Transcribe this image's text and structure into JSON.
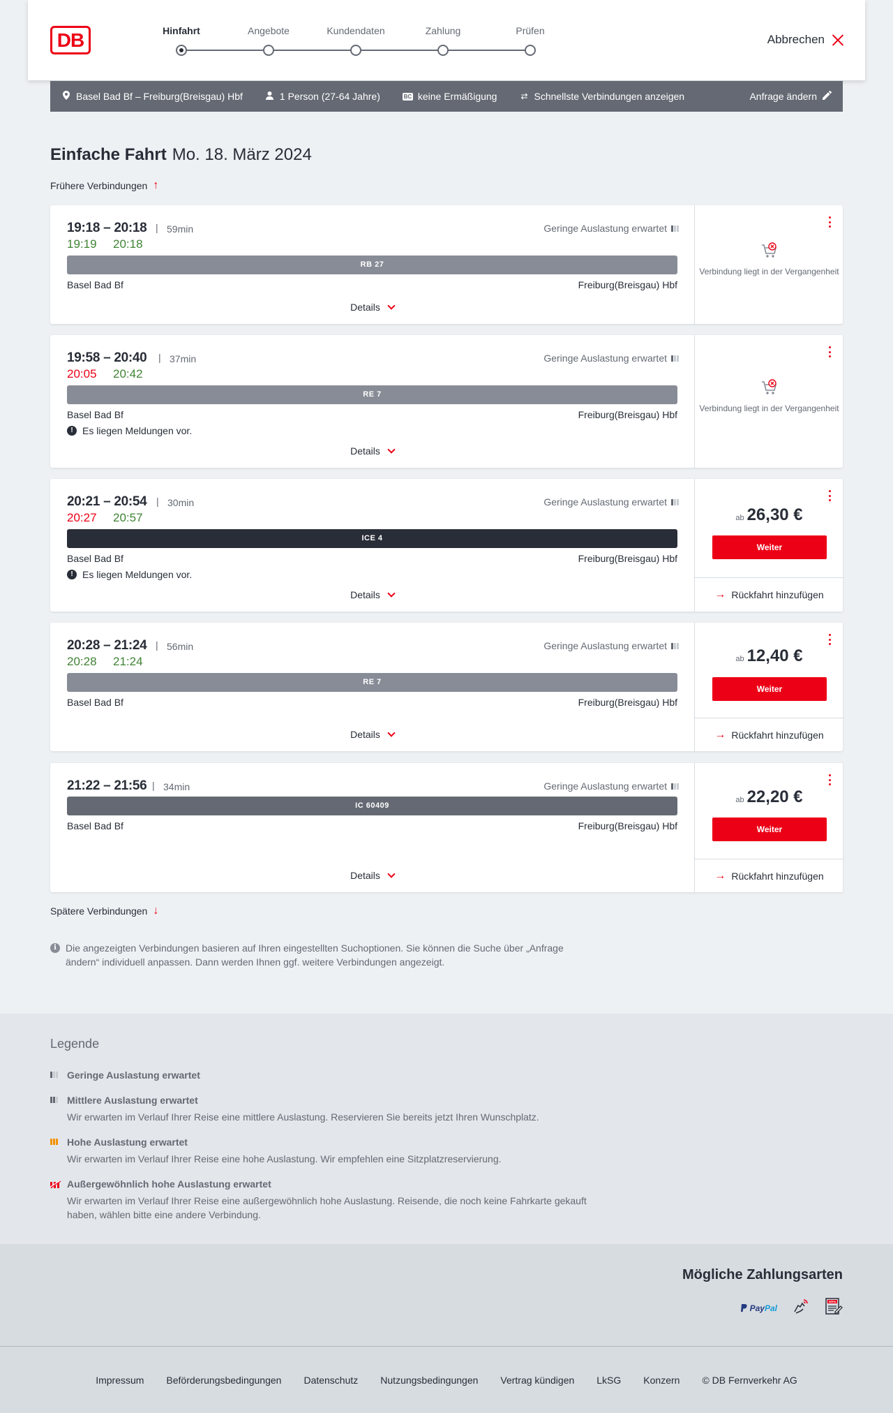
{
  "header": {
    "logo": "DB",
    "steps": [
      "Hinfahrt",
      "Angebote",
      "Kundendaten",
      "Zahlung",
      "Prüfen"
    ],
    "cancel": "Abbrechen"
  },
  "summary": {
    "route": "Basel Bad Bf – Freiburg(Breisgau) Hbf",
    "passengers": "1 Person (27-64 Jahre)",
    "discount": "keine Ermäßigung",
    "fastest": "Schnellste Verbindungen anzeigen",
    "change": "Anfrage ändern"
  },
  "page": {
    "title": "Einfache Fahrt",
    "date": "Mo. 18. März 2024",
    "earlier": "Frühere Verbindungen",
    "later": "Spätere Verbindungen",
    "info": "Die angezeigten Verbindungen basieren auf Ihren eingestellten Suchoptionen. Sie können die Suche über „Anfrage ändern“ individuell anpassen. Dann werden Ihnen ggf. weitere Verbindungen angezeigt."
  },
  "connections": [
    {
      "times": "19:18 – 20:18",
      "duration": "59min",
      "rt_dep": "19:19",
      "rt_arr": "20:18",
      "occupancy": "Geringe Auslastung erwartet",
      "train": "RB 27",
      "from": "Basel Bad Bf",
      "to": "Freiburg(Breisgau) Hbf",
      "message": "",
      "details": "Details",
      "past": "Verbindung liegt in der Vergangenheit"
    },
    {
      "times": "19:58 – 20:40",
      "duration": "37min",
      "rt_dep": "20:05",
      "rt_arr": "20:42",
      "occupancy": "Geringe Auslastung erwartet",
      "train": "RE 7",
      "from": "Basel Bad Bf",
      "to": "Freiburg(Breisgau) Hbf",
      "message": "Es liegen Meldungen vor.",
      "details": "Details",
      "past": "Verbindung liegt in der Vergangenheit"
    },
    {
      "times": "20:21 – 20:54",
      "duration": "30min",
      "rt_dep": "20:27",
      "rt_arr": "20:57",
      "occupancy": "Geringe Auslastung erwartet",
      "train": "ICE 4",
      "from": "Basel Bad Bf",
      "to": "Freiburg(Breisgau) Hbf",
      "message": "Es liegen Meldungen vor.",
      "details": "Details",
      "price_prefix": "ab",
      "price": "26,30 €",
      "button": "Weiter",
      "return": "Rückfahrt hinzufügen"
    },
    {
      "times": "20:28 – 21:24",
      "duration": "56min",
      "rt_dep": "20:28",
      "rt_arr": "21:24",
      "occupancy": "Geringe Auslastung erwartet",
      "train": "RE 7",
      "from": "Basel Bad Bf",
      "to": "Freiburg(Breisgau) Hbf",
      "message": "",
      "details": "Details",
      "price_prefix": "ab",
      "price": "12,40 €",
      "button": "Weiter",
      "return": "Rückfahrt hinzufügen"
    },
    {
      "times": "21:22 – 21:56",
      "duration": "34min",
      "occupancy": "Geringe Auslastung erwartet",
      "train": "IC 60409",
      "from": "Basel Bad Bf",
      "to": "Freiburg(Breisgau) Hbf",
      "message": "",
      "details": "Details",
      "price_prefix": "ab",
      "price": "22,20 €",
      "button": "Weiter",
      "return": "Rückfahrt hinzufügen"
    }
  ],
  "legend": {
    "title": "Legende",
    "items": [
      {
        "title": "Geringe Auslastung erwartet",
        "desc": ""
      },
      {
        "title": "Mittlere Auslastung erwartet",
        "desc": "Wir erwarten im Verlauf Ihrer Reise eine mittlere Auslastung. Reservieren Sie bereits jetzt Ihren Wunschplatz."
      },
      {
        "title": "Hohe Auslastung erwartet",
        "desc": "Wir erwarten im Verlauf Ihrer Reise eine hohe Auslastung. Wir empfehlen eine Sitzplatzreservierung."
      },
      {
        "title": "Außergewöhnlich hohe Auslastung erwartet",
        "desc": "Wir erwarten im Verlauf Ihrer Reise eine außergewöhnlich hohe Auslastung. Reisende, die noch keine Fahrkarte gekauft haben, wählen bitte eine andere Verbindung."
      }
    ]
  },
  "payment": {
    "title": "Mögliche Zahlungsarten",
    "paypal_a": "Pay",
    "paypal_b": "Pal",
    "sepa": "SEPA"
  },
  "footer": [
    "Impressum",
    "Beförderungsbedingungen",
    "Datenschutz",
    "Nutzungsbedingungen",
    "Vertrag kündigen",
    "LkSG",
    "Konzern",
    "© DB Fernverkehr AG"
  ],
  "colors": {
    "accent": "#ec0016",
    "on_time": "#408335",
    "delayed": "#ec0016",
    "summary_bar": "#646973"
  }
}
